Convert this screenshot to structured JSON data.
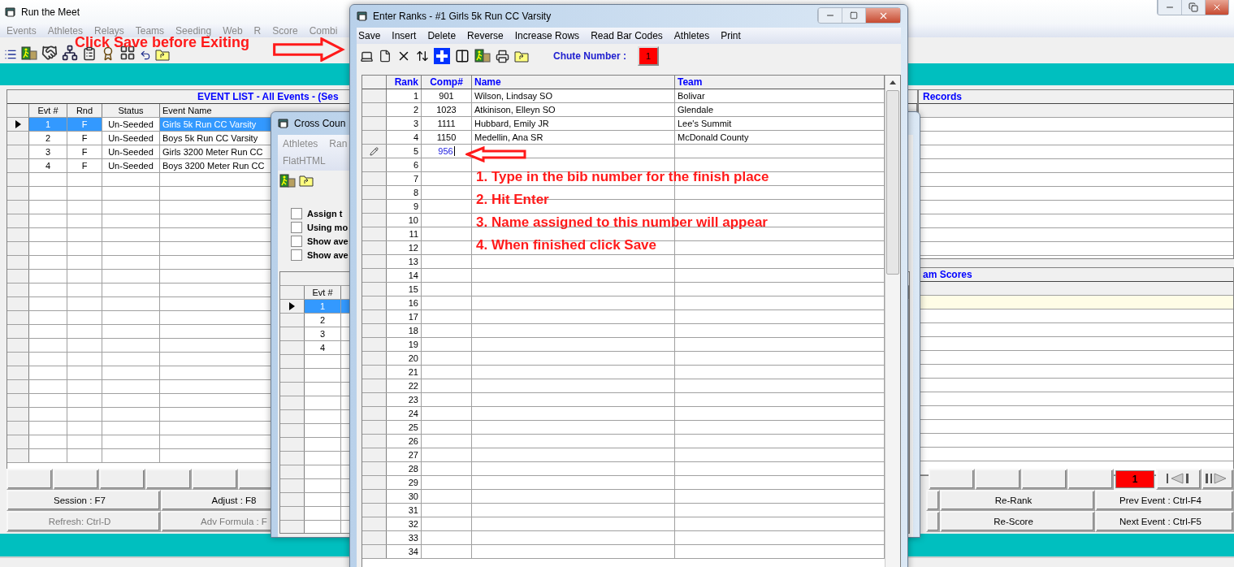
{
  "main_window": {
    "title": "Run the Meet",
    "menu": [
      "Events",
      "Athletes",
      "Relays",
      "Teams",
      "Seeding",
      "Web",
      "R",
      "Score",
      "Combi"
    ],
    "annotation": "Click Save before Exiting"
  },
  "event_list": {
    "title": "EVENT LIST - All Events - (Ses",
    "columns": [
      "Evt #",
      "Rnd",
      "Status",
      "Event Name"
    ],
    "rows": [
      {
        "evt": "1",
        "rnd": "F",
        "status": "Un-Seeded",
        "name": "Girls 5k Run CC Varsity",
        "selected": true
      },
      {
        "evt": "2",
        "rnd": "F",
        "status": "Un-Seeded",
        "name": "Boys 5k Run CC Varsity",
        "selected": false
      },
      {
        "evt": "3",
        "rnd": "F",
        "status": "Un-Seeded",
        "name": "Girls 3200 Meter Run CC",
        "selected": false
      },
      {
        "evt": "4",
        "rnd": "F",
        "status": "Un-Seeded",
        "name": "Boys 3200 Meter Run CC",
        "selected": false
      }
    ]
  },
  "records": {
    "title": "Records"
  },
  "team_scores": {
    "title": "am Scores"
  },
  "function_keys": {
    "left": [
      [
        {
          "label": "Session : F7",
          "disabled": false
        },
        {
          "label": "Adjust : F8",
          "disabled": false
        }
      ],
      [
        {
          "label": "Refresh: Ctrl-D",
          "disabled": true
        },
        {
          "label": "Adv Formula : F",
          "disabled": true
        }
      ]
    ],
    "right": [
      [
        {
          "label": "Re-Rank",
          "disabled": false
        },
        {
          "label": "Prev Event : Ctrl-F4",
          "disabled": false
        }
      ],
      [
        {
          "label": "Re-Score",
          "disabled": false
        },
        {
          "label": "Next Event : Ctrl-F5",
          "disabled": false
        }
      ]
    ],
    "event_counter": "1"
  },
  "cross_country": {
    "title": "Cross Coun",
    "menu": [
      "Athletes",
      "Ran",
      "FlatHTML"
    ],
    "options": [
      {
        "label": "Assign t",
        "checked": false
      },
      {
        "label": "Using mo",
        "checked": false
      },
      {
        "label": "Show ave",
        "checked": false
      },
      {
        "label": "Show ave",
        "checked": false
      }
    ],
    "column": "Evt #",
    "rows": [
      {
        "evt": "1",
        "selected": true
      },
      {
        "evt": "2",
        "selected": false
      },
      {
        "evt": "3",
        "selected": false
      },
      {
        "evt": "4",
        "selected": false
      }
    ]
  },
  "enter_ranks": {
    "title": "Enter Ranks - #1 Girls 5k Run CC Varsity",
    "menu": [
      "Save",
      "Insert",
      "Delete",
      "Reverse",
      "Increase Rows",
      "Read Bar Codes",
      "Athletes",
      "Print"
    ],
    "chute_label": "Chute Number :",
    "chute_number": "1",
    "columns": [
      "Rank",
      "Comp#",
      "Name",
      "Team"
    ],
    "rows": [
      {
        "rank": "1",
        "comp": "901",
        "name": "Wilson, Lindsay SO",
        "team": "Bolivar",
        "editing": false
      },
      {
        "rank": "2",
        "comp": "1023",
        "name": "Atkinison, Elleyn SO",
        "team": "Glendale",
        "editing": false
      },
      {
        "rank": "3",
        "comp": "1111",
        "name": "Hubbard, Emily JR",
        "team": "Lee's Summit",
        "editing": false
      },
      {
        "rank": "4",
        "comp": "1150",
        "name": "Medellin, Ana SR",
        "team": "McDonald County",
        "editing": false
      },
      {
        "rank": "5",
        "comp": "956",
        "editing": true
      },
      {
        "rank": "6"
      },
      {
        "rank": "7"
      },
      {
        "rank": "8"
      },
      {
        "rank": "9"
      },
      {
        "rank": "10"
      },
      {
        "rank": "11"
      },
      {
        "rank": "12"
      },
      {
        "rank": "13"
      },
      {
        "rank": "14"
      },
      {
        "rank": "15"
      },
      {
        "rank": "16"
      },
      {
        "rank": "17"
      },
      {
        "rank": "18"
      },
      {
        "rank": "19"
      },
      {
        "rank": "20"
      },
      {
        "rank": "21"
      },
      {
        "rank": "22"
      },
      {
        "rank": "23"
      },
      {
        "rank": "24"
      },
      {
        "rank": "25"
      },
      {
        "rank": "26"
      },
      {
        "rank": "27"
      },
      {
        "rank": "28"
      },
      {
        "rank": "29"
      },
      {
        "rank": "30"
      },
      {
        "rank": "31"
      },
      {
        "rank": "32"
      },
      {
        "rank": "33"
      },
      {
        "rank": "34"
      }
    ],
    "instructions": [
      "1. Type in the bib number for the finish place",
      "2. Hit Enter",
      "3. Name assigned to this number will appear",
      "4. When finished click Save"
    ]
  }
}
